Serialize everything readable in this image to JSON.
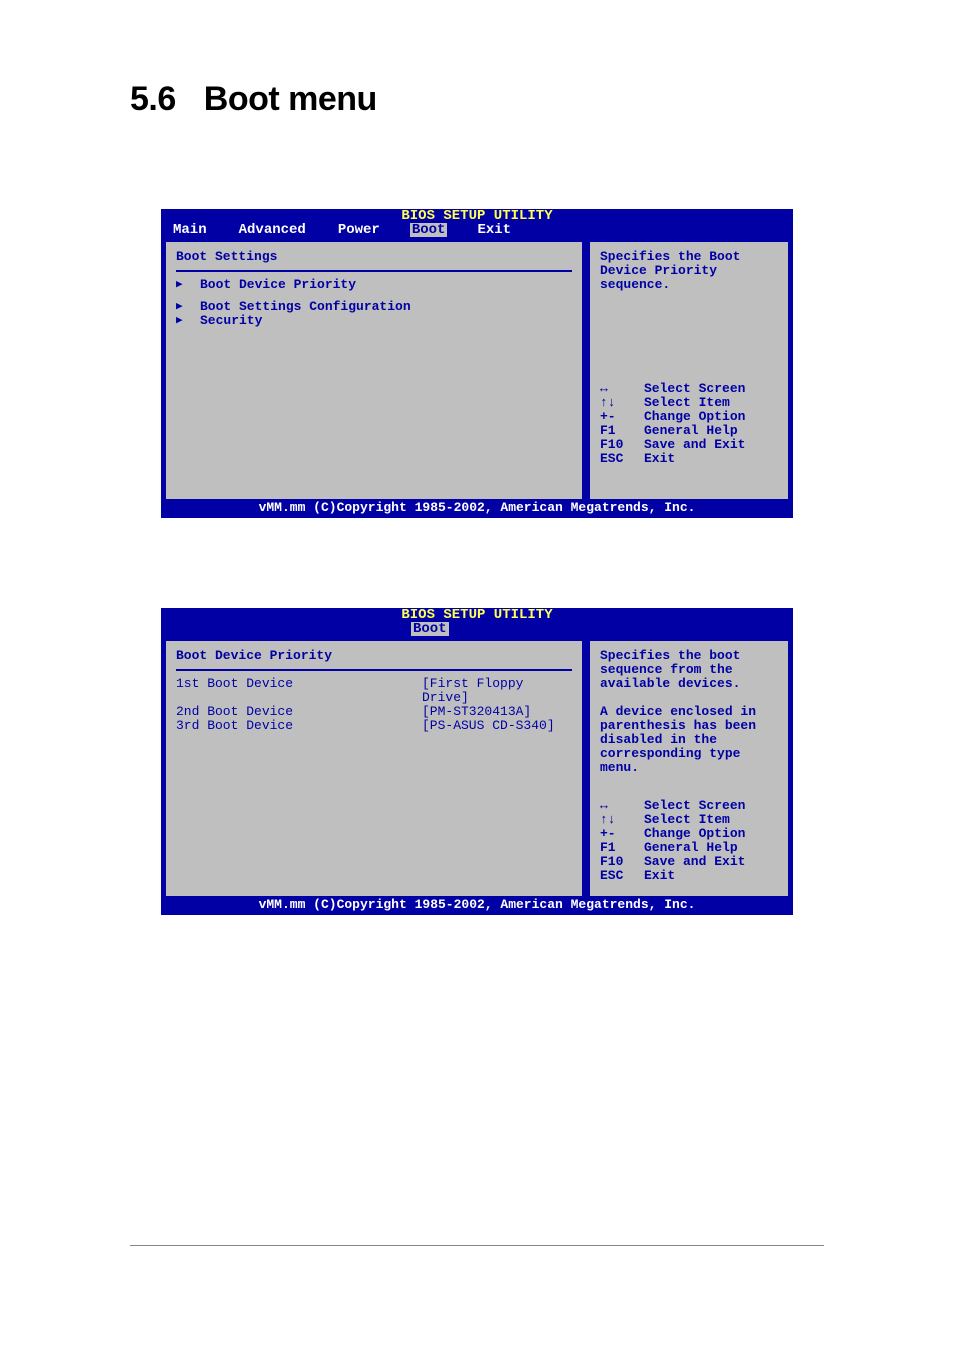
{
  "heading": {
    "number": "5.6",
    "title": "Boot menu"
  },
  "legend": [
    {
      "key": "↔",
      "label": "Select Screen"
    },
    {
      "key": "↑↓",
      "label": "Select Item"
    },
    {
      "key": "+-",
      "label": "Change Option"
    },
    {
      "key": "F1",
      "label": "General Help"
    },
    {
      "key": "F10",
      "label": "Save and Exit"
    },
    {
      "key": "ESC",
      "label": "Exit"
    }
  ],
  "copyright": "vMM.mm (C)Copyright 1985-2002, American Megatrends, Inc.",
  "bios1": {
    "title": "BIOS SETUP UTILITY",
    "menu": [
      "Main",
      "Advanced",
      "Power",
      "Boot",
      "Exit"
    ],
    "selected": "Boot",
    "section": "Boot Settings",
    "items": [
      "Boot Device Priority",
      "Boot Settings Configuration",
      "Security"
    ],
    "help": "Specifies the Boot Device Priority sequence."
  },
  "bios2": {
    "title": "BIOS SETUP UTILITY",
    "menu": [
      "Boot"
    ],
    "selected": "Boot",
    "section": "Boot Device Priority",
    "rows": [
      {
        "label": "1st Boot Device",
        "value": "[First Floppy Drive]"
      },
      {
        "label": "2nd Boot Device",
        "value": "[PM-ST320413A]"
      },
      {
        "label": "3rd Boot Device",
        "value": "[PS-ASUS CD-S340]"
      }
    ],
    "help1": "Specifies the boot sequence from the available devices.",
    "help2": "A device enclosed in parenthesis has been disabled in the corresponding type menu."
  }
}
